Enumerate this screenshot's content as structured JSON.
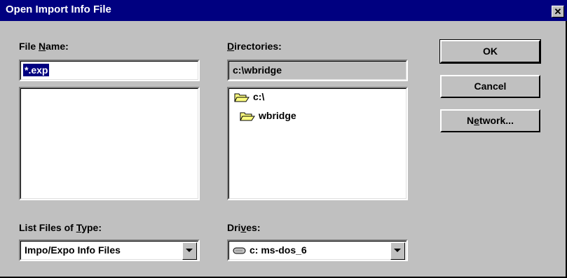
{
  "window": {
    "title": "Open Import Info File",
    "close_glyph": "✕"
  },
  "file_name": {
    "label_prefix": "File ",
    "label_accel": "N",
    "label_suffix": "ame:",
    "value": "*.exp",
    "files": []
  },
  "directories": {
    "label_accel": "D",
    "label_suffix": "irectories:",
    "path": "c:\\wbridge",
    "items": [
      {
        "label": "c:\\",
        "icon": "open-folder-icon"
      },
      {
        "label": "wbridge",
        "icon": "open-folder-icon"
      }
    ]
  },
  "file_type": {
    "label_prefix": "List Files of ",
    "label_accel": "T",
    "label_suffix": "ype:",
    "selected": "Impo/Expo Info Files"
  },
  "drives": {
    "label_prefix": "Dri",
    "label_accel": "v",
    "label_suffix": "es:",
    "selected": "c: ms-dos_6",
    "icon": "hard-drive-icon"
  },
  "buttons": {
    "ok": "OK",
    "cancel": "Cancel",
    "network_prefix": "N",
    "network_accel": "e",
    "network_suffix": "twork..."
  },
  "colors": {
    "title_bar": "#000080",
    "face": "#c0c0c0",
    "folder_yellow": "#ffff80"
  }
}
